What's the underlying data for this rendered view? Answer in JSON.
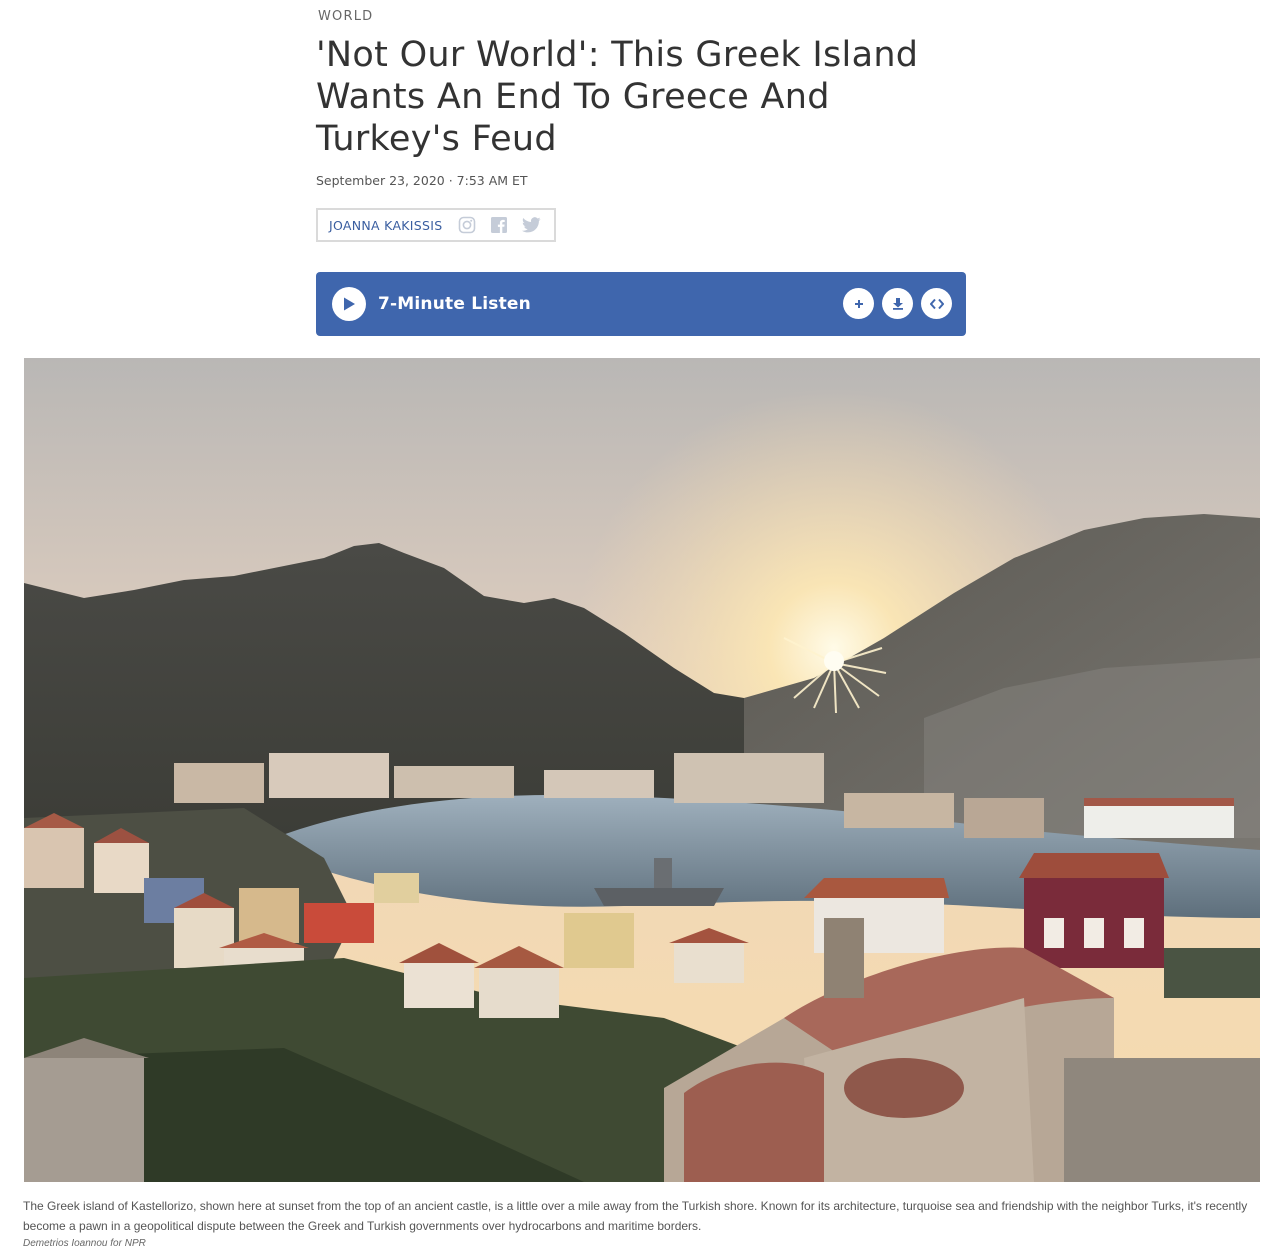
{
  "article": {
    "section": "WORLD",
    "headline": "'Not Our World': This Greek Island Wants An End To Greece And Turkey's Feud",
    "dateline": "September 23, 2020 · 7:53 AM ET",
    "byline": "JOANNA KAKISSIS",
    "social_icons": [
      "instagram-icon",
      "facebook-icon",
      "twitter-icon"
    ]
  },
  "audio": {
    "label": "7-Minute Listen",
    "actions": [
      "add-icon",
      "download-icon",
      "embed-icon"
    ]
  },
  "image": {
    "caption": "The Greek island of Kastellorizo, shown here at sunset from the top of an ancient castle, is a little over a mile away from the Turkish shore. Known for its architecture, turquoise sea and friendship with the neighbor Turks, it's recently become a pawn in a geopolitical dispute between the Greek and Turkish governments over hydrocarbons and maritime borders.",
    "credit": "Demetrios Ioannou for NPR"
  },
  "colors": {
    "accent": "#3f66ad",
    "byline": "#3a5ea0",
    "border": "#dadada"
  }
}
